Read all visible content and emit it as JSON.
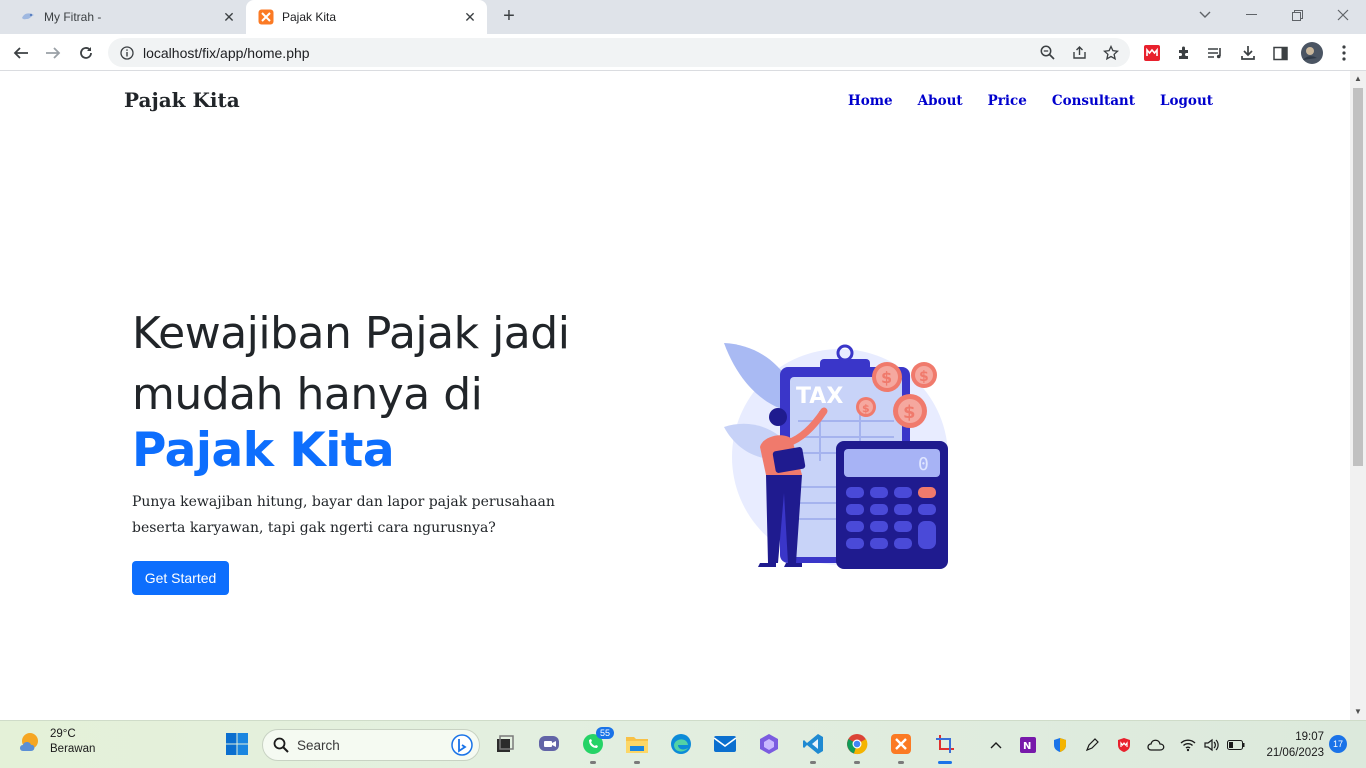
{
  "browser": {
    "tabs": [
      {
        "title": "My Fitrah -",
        "active": false
      },
      {
        "title": "Pajak Kita",
        "active": true
      }
    ],
    "url": "localhost/fix/app/home.php"
  },
  "site": {
    "brand": "Pajak Kita",
    "nav": [
      "Home",
      "About",
      "Price",
      "Consultant",
      "Logout"
    ],
    "hero": {
      "title": "Kewajiban Pajak jadi mudah hanya di",
      "brand": "Pajak Kita",
      "description": "Punya kewajiban hitung, bayar dan lapor pajak perusahaan beserta karyawan, tapi gak ngerti cara ngurusnya?",
      "cta": "Get Started"
    },
    "illustration": {
      "clipboard_label": "TAX",
      "calculator_display": "0"
    }
  },
  "taskbar": {
    "weather": {
      "temp": "29°C",
      "condition": "Berawan"
    },
    "search_label": "Search",
    "whatsapp_badge": "55",
    "time": "19:07",
    "date": "21/06/2023",
    "notifications": "17"
  },
  "colors": {
    "primary": "#0d6efd",
    "nav_link": "#0000cd",
    "illustration_blue": "#3a36c9",
    "illustration_coin": "#f07a6c"
  }
}
